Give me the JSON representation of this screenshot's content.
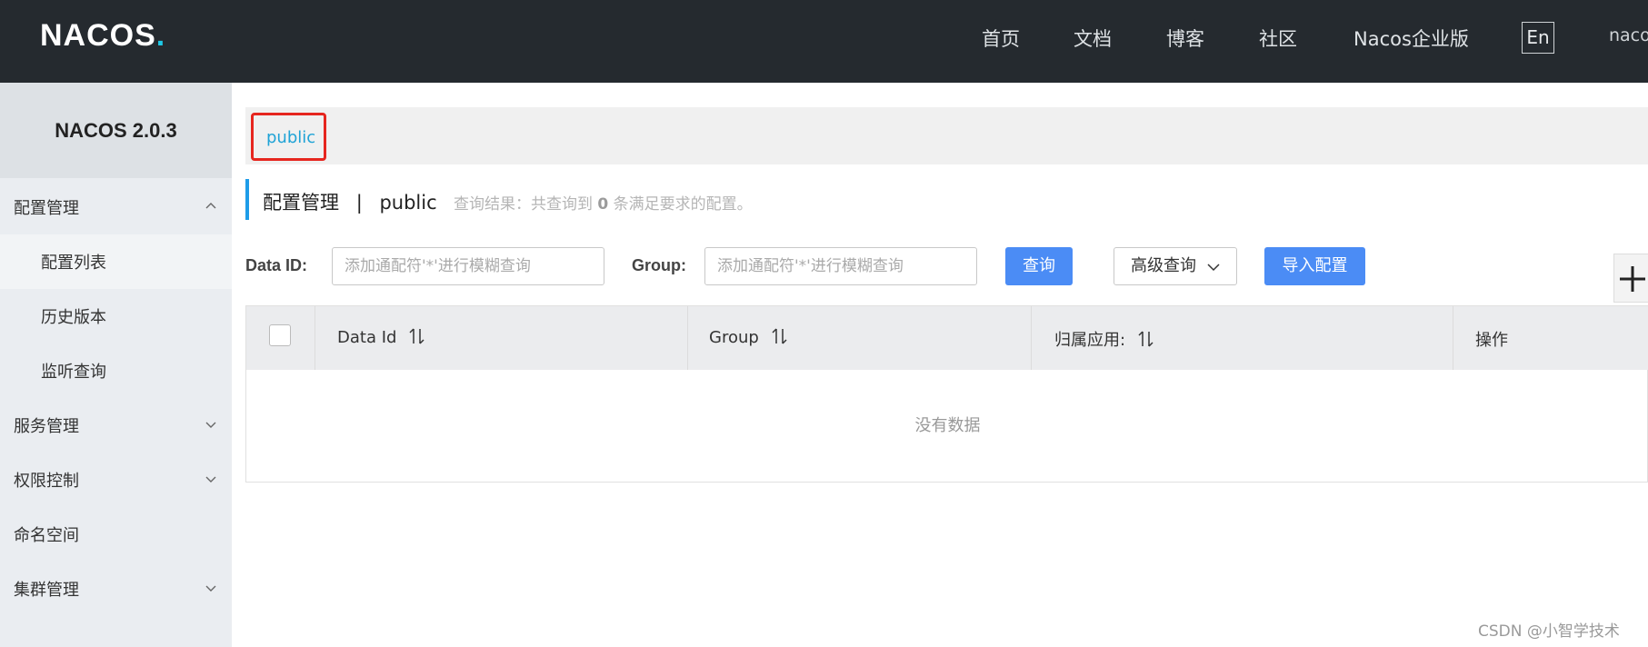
{
  "header": {
    "logo_text": "NACOS",
    "logo_dot": ".",
    "nav": [
      "首页",
      "文档",
      "博客",
      "社区",
      "Nacos企业版"
    ],
    "lang_button": "En",
    "user": "nacos"
  },
  "sidebar": {
    "version": "NACOS 2.0.3",
    "items": [
      {
        "label": "配置管理",
        "expanded": true
      },
      {
        "label": "配置列表",
        "active": true
      },
      {
        "label": "历史版本"
      },
      {
        "label": "监听查询"
      },
      {
        "label": "服务管理",
        "expanded": false
      },
      {
        "label": "权限控制",
        "expanded": false
      },
      {
        "label": "命名空间"
      },
      {
        "label": "集群管理",
        "expanded": false
      }
    ]
  },
  "namespace": {
    "current": "public"
  },
  "page": {
    "title": "配置管理",
    "separator": "|",
    "namespace": "public",
    "result_prefix": "查询结果：共查询到",
    "result_count": "0",
    "result_suffix": "条满足要求的配置。"
  },
  "filters": {
    "data_id_label": "Data ID:",
    "data_id_placeholder": "添加通配符'*'进行模糊查询",
    "group_label": "Group:",
    "group_placeholder": "添加通配符'*'进行模糊查询",
    "search_button": "查询",
    "advanced_button": "高级查询",
    "import_button": "导入配置"
  },
  "table": {
    "columns": [
      "Data Id",
      "Group",
      "归属应用:",
      "操作"
    ],
    "empty_text": "没有数据"
  },
  "watermark": "CSDN @小智学技术",
  "colors": {
    "header_bg": "#252a2f",
    "sidebar_bg": "#eaedf1",
    "primary": "#4b8cf5",
    "link": "#1fa3d6",
    "highlight_box": "#e6261f"
  }
}
